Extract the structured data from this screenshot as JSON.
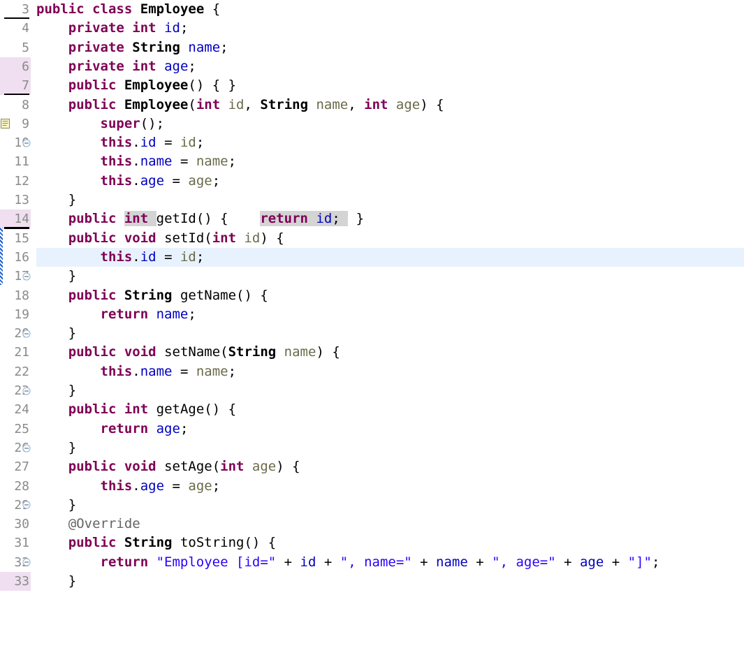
{
  "editor": {
    "language": "java",
    "file_class": "Employee",
    "first_visible_line": 3,
    "last_visible_line": 33,
    "current_line": 16,
    "colors": {
      "keyword": "#7f0055",
      "field": "#0000c0",
      "string": "#2a00ff",
      "parameter": "#6a6a4a",
      "annotation": "#646464",
      "current_line_bg": "#e8f2fe",
      "gutter_highlight_bg": "#efdff0",
      "occurrence_highlight_bg": "#d4d4d4",
      "change_marker": "#1a5fd0",
      "line_number": "#8a8a8a",
      "background": "#ffffff"
    },
    "icons": {
      "fold_collapse": "fold-collapse-icon",
      "task": "task-marker-icon"
    },
    "lines": [
      {
        "n": "3",
        "text": "public class Employee {"
      },
      {
        "n": "4",
        "text": "    private int id;"
      },
      {
        "n": "5",
        "text": "    private String name;"
      },
      {
        "n": "6",
        "text": "    private int age;"
      },
      {
        "n": "7",
        "text": "    public Employee() { }"
      },
      {
        "n": "8",
        "text": "    public Employee(int id, String name, int age) {"
      },
      {
        "n": "9",
        "text": "        super();"
      },
      {
        "n": "10",
        "text": "        this.id = id;"
      },
      {
        "n": "11",
        "text": "        this.name = name;"
      },
      {
        "n": "12",
        "text": "        this.age = age;"
      },
      {
        "n": "13",
        "text": "    }"
      },
      {
        "n": "14",
        "text": "    public int getId() {    return id;  }"
      },
      {
        "n": "15",
        "text": "    public void setId(int id) {"
      },
      {
        "n": "16",
        "text": "        this.id = id;"
      },
      {
        "n": "17",
        "text": "    }"
      },
      {
        "n": "18",
        "text": "    public String getName() {"
      },
      {
        "n": "19",
        "text": "        return name;"
      },
      {
        "n": "20",
        "text": "    }"
      },
      {
        "n": "21",
        "text": "    public void setName(String name) {"
      },
      {
        "n": "22",
        "text": "        this.name = name;"
      },
      {
        "n": "23",
        "text": "    }"
      },
      {
        "n": "24",
        "text": "    public int getAge() {"
      },
      {
        "n": "25",
        "text": "        return age;"
      },
      {
        "n": "26",
        "text": "    }"
      },
      {
        "n": "27",
        "text": "    public void setAge(int age) {"
      },
      {
        "n": "28",
        "text": "        this.age = age;"
      },
      {
        "n": "29",
        "text": "    }"
      },
      {
        "n": "30",
        "text": "    @Override"
      },
      {
        "n": "31",
        "text": "    public String toString() {"
      },
      {
        "n": "32",
        "text": "        return \"Employee [id=\" + id + \", name=\" + name + \", age=\" + age + \"]\";"
      },
      {
        "n": "33",
        "text": "    }"
      }
    ]
  }
}
